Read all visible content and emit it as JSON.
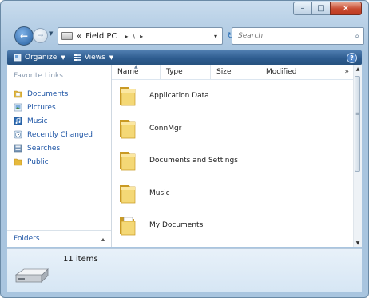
{
  "window": {
    "controls": {
      "minimize": "–",
      "maximize": "□",
      "close": "✕"
    }
  },
  "address": {
    "back_glyph": "←",
    "forward_glyph": "→",
    "prefix": "«",
    "segment": "Field PC",
    "sep1": "▸",
    "sep2": "\\",
    "sep3": "▸",
    "dropdown_glyph": "▾",
    "refresh_glyph": "↻"
  },
  "search": {
    "placeholder": "Search"
  },
  "toolbar": {
    "organize_label": "Organize",
    "views_label": "Views",
    "help_label": "?"
  },
  "favorites": {
    "title": "Favorite Links",
    "items": [
      {
        "label": "Documents",
        "icon": "documents-icon"
      },
      {
        "label": "Pictures",
        "icon": "pictures-icon"
      },
      {
        "label": "Music",
        "icon": "music-icon"
      },
      {
        "label": "Recently Changed",
        "icon": "recent-icon"
      },
      {
        "label": "Searches",
        "icon": "searches-icon"
      },
      {
        "label": "Public",
        "icon": "public-icon"
      }
    ]
  },
  "folders_pane": {
    "label": "Folders",
    "chevron": "▴"
  },
  "columns": {
    "name": "Name",
    "type": "Type",
    "size": "Size",
    "modified": "Modified",
    "more": "»"
  },
  "files": [
    {
      "name": "Application Data"
    },
    {
      "name": "ConnMgr"
    },
    {
      "name": "Documents and Settings"
    },
    {
      "name": "Music"
    },
    {
      "name": "My Documents"
    }
  ],
  "status": {
    "item_count": "11 items"
  },
  "colors": {
    "link": "#1f56a6",
    "command_bar": "#2e5c8f",
    "folder": "#e9c34b",
    "status_bg": "#dbe9f6"
  }
}
